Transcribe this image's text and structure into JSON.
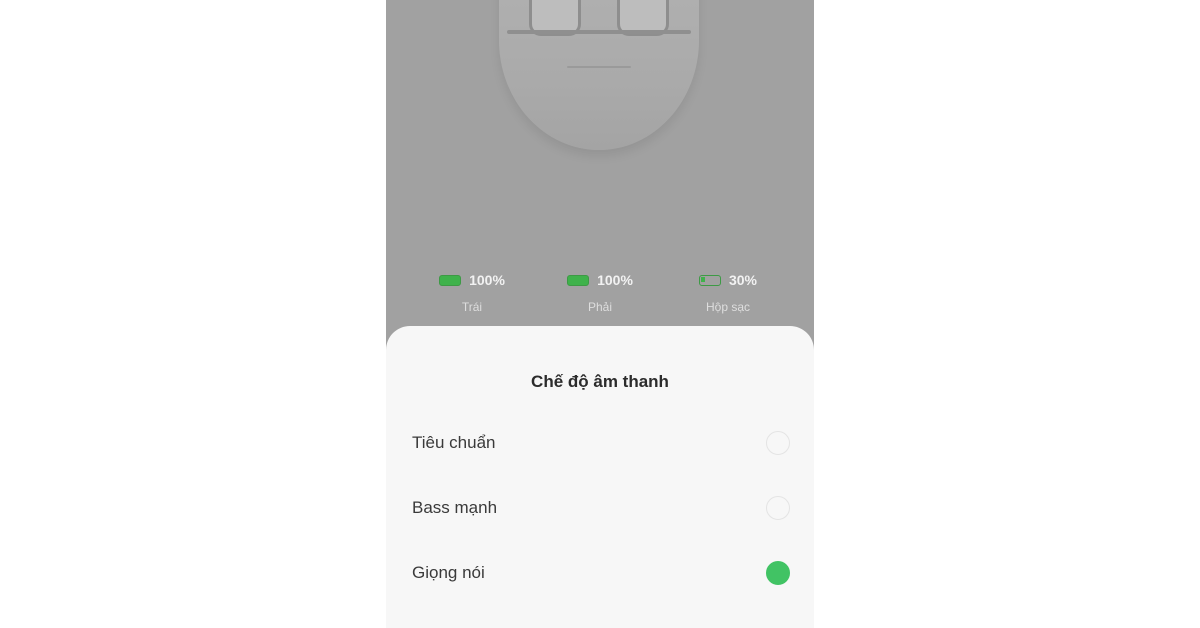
{
  "colors": {
    "top_background": "#a1a1a1",
    "sheet_background": "#f7f7f7",
    "accent_green": "#41c364"
  },
  "battery": [
    {
      "value": "100%",
      "label": "Trái",
      "icon": "battery-full-icon"
    },
    {
      "value": "100%",
      "label": "Phải",
      "icon": "battery-full-icon"
    },
    {
      "value": "30%",
      "label": "Hộp sạc",
      "icon": "battery-low-icon"
    }
  ],
  "sheet": {
    "title": "Chế độ âm thanh",
    "options": [
      {
        "label": "Tiêu chuẩn",
        "selected": false
      },
      {
        "label": "Bass mạnh",
        "selected": false
      },
      {
        "label": "Giọng nói",
        "selected": true
      }
    ]
  }
}
